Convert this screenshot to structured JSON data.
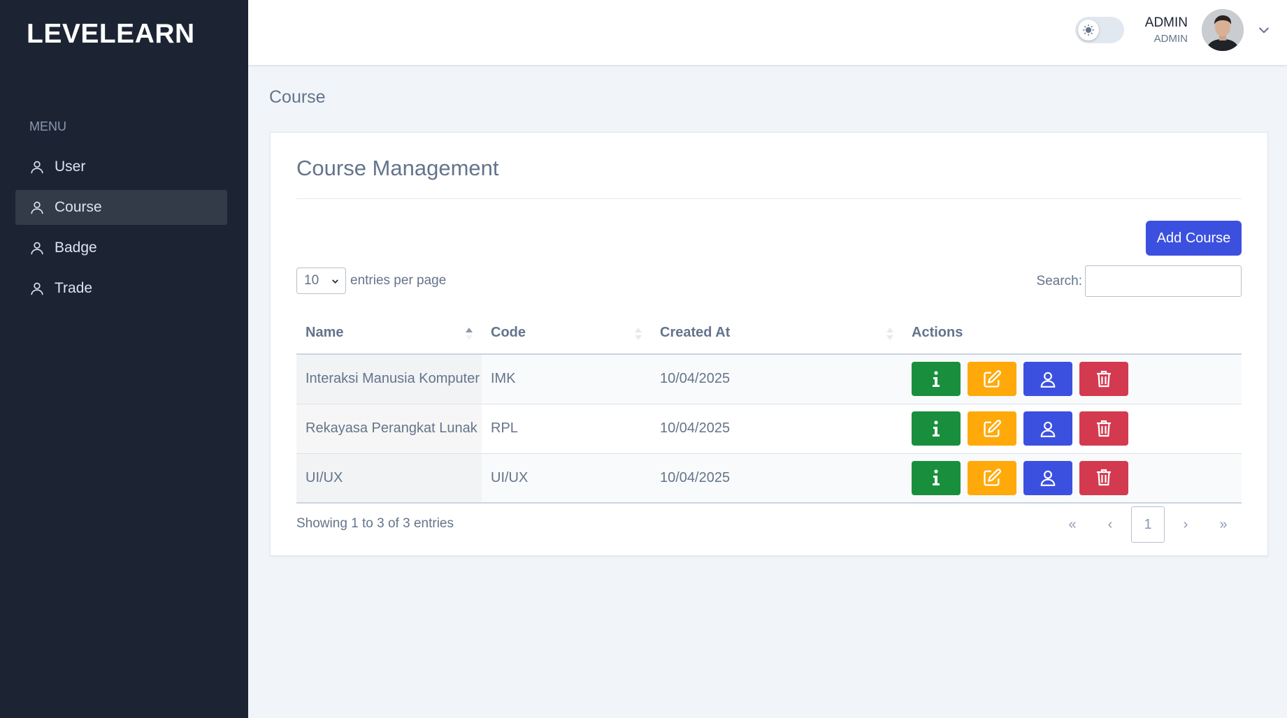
{
  "app": {
    "name": "LEVELEARN"
  },
  "sidebar": {
    "menu_title": "MENU",
    "items": [
      {
        "label": "User",
        "icon": "user-icon",
        "active": false
      },
      {
        "label": "Course",
        "icon": "user-icon",
        "active": true
      },
      {
        "label": "Badge",
        "icon": "user-icon",
        "active": false
      },
      {
        "label": "Trade",
        "icon": "user-icon",
        "active": false
      }
    ]
  },
  "header": {
    "theme_toggle_icon": "sun-icon",
    "user_name": "ADMIN",
    "user_role": "ADMIN"
  },
  "page": {
    "title": "Course"
  },
  "card": {
    "title": "Course Management",
    "add_button": "Add Course",
    "entries": {
      "value": "10",
      "label": "entries per page"
    },
    "search": {
      "label": "Search:",
      "value": "",
      "placeholder": ""
    },
    "table": {
      "columns": [
        "Name",
        "Code",
        "Created At",
        "Actions"
      ],
      "rows": [
        {
          "name": "Interaksi Manusia Komputer",
          "code": "IMK",
          "created_at": "10/04/2025"
        },
        {
          "name": "Rekayasa Perangkat Lunak",
          "code": "RPL",
          "created_at": "10/04/2025"
        },
        {
          "name": "UI/UX",
          "code": "UI/UX",
          "created_at": "10/04/2025"
        }
      ],
      "row_actions": [
        "info-icon",
        "edit-icon",
        "user-icon",
        "trash-icon"
      ]
    },
    "footer": {
      "showing": "Showing 1 to 3 of 3 entries",
      "pagination": {
        "first": "«",
        "prev": "‹",
        "current": "1",
        "next": "›",
        "last": "»"
      }
    }
  },
  "colors": {
    "sidebar_bg": "#1c2434",
    "primary": "#3c50e0",
    "success": "#198f3e",
    "warning": "#ffa90a",
    "danger": "#d33a4f"
  }
}
